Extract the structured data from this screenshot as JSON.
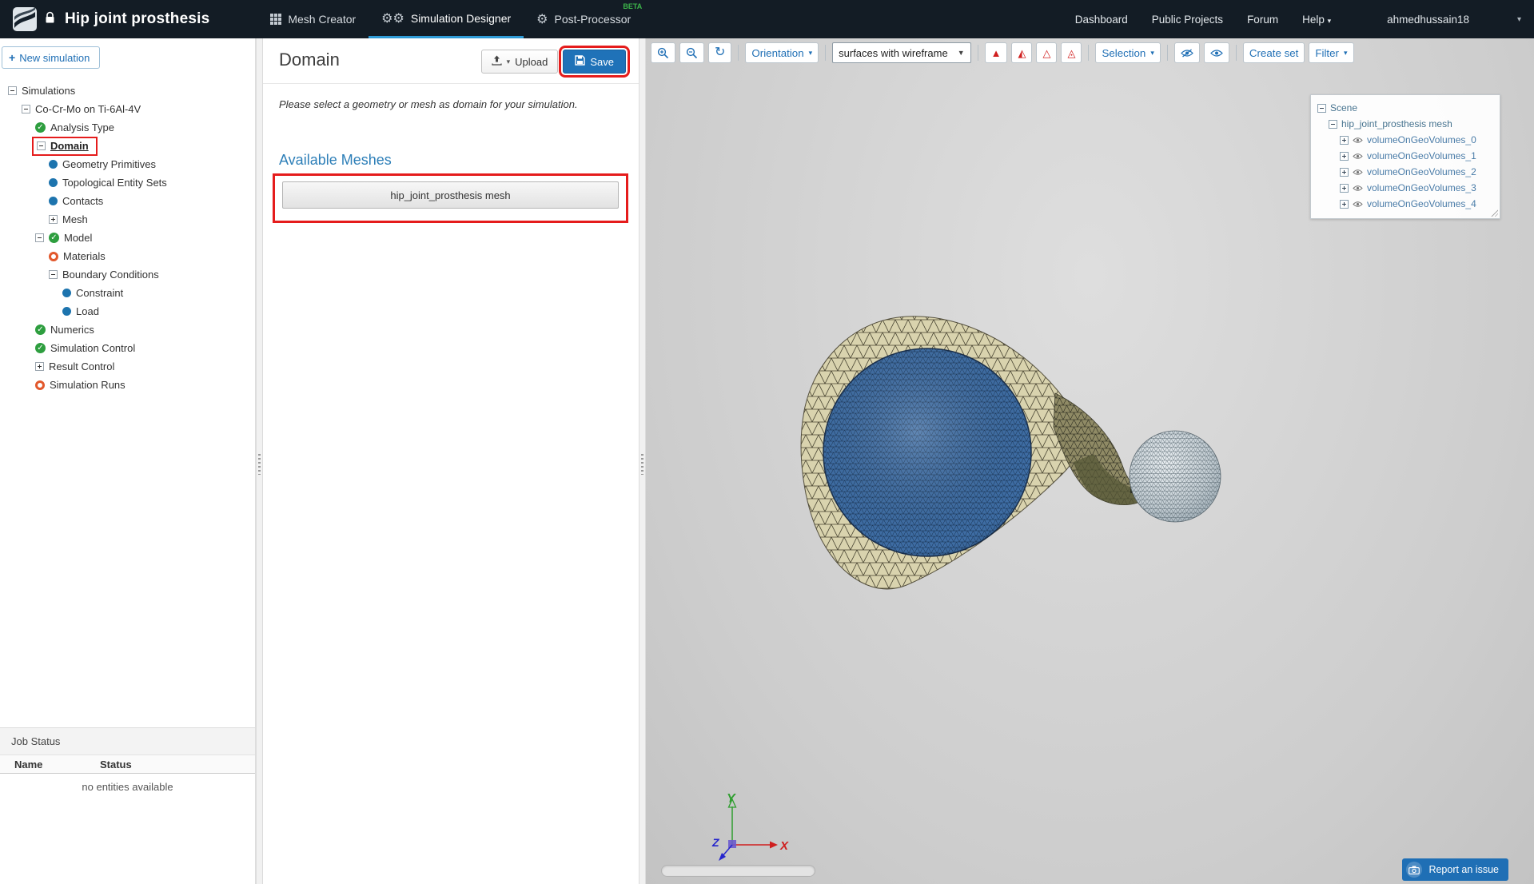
{
  "topbar": {
    "title": "Hip joint prosthesis",
    "tabs": [
      {
        "label": "Mesh Creator"
      },
      {
        "label": "Simulation Designer"
      },
      {
        "label": "Post-Processor",
        "beta": "BETA"
      }
    ],
    "links": {
      "dashboard": "Dashboard",
      "public_projects": "Public Projects",
      "forum": "Forum",
      "help": "Help"
    },
    "user": "ahmedhussain18"
  },
  "sidebar": {
    "new_simulation": "New simulation",
    "tree": [
      {
        "label": "Simulations",
        "level": 0,
        "expander": "minus"
      },
      {
        "label": "Co-Cr-Mo on Ti-6Al-4V",
        "level": 1,
        "expander": "minus"
      },
      {
        "label": "Analysis Type",
        "level": 2,
        "status": "complete"
      },
      {
        "label": "Domain",
        "level": 2,
        "expander": "minus",
        "selected": true,
        "annotated": true
      },
      {
        "label": "Geometry Primitives",
        "level": 3,
        "status": "item"
      },
      {
        "label": "Topological Entity Sets",
        "level": 3,
        "status": "item"
      },
      {
        "label": "Contacts",
        "level": 3,
        "status": "item"
      },
      {
        "label": "Mesh",
        "level": 3,
        "expander": "plus"
      },
      {
        "label": "Model",
        "level": 2,
        "expander": "minus",
        "status": "complete"
      },
      {
        "label": "Materials",
        "level": 3,
        "status": "incomplete"
      },
      {
        "label": "Boundary Conditions",
        "level": 3,
        "expander": "minus"
      },
      {
        "label": "Constraint",
        "level": 4,
        "status": "item"
      },
      {
        "label": "Load",
        "level": 4,
        "status": "item"
      },
      {
        "label": "Numerics",
        "level": 2,
        "status": "complete"
      },
      {
        "label": "Simulation Control",
        "level": 2,
        "status": "complete"
      },
      {
        "label": "Result Control",
        "level": 2,
        "expander": "plus"
      },
      {
        "label": "Simulation Runs",
        "level": 2,
        "status": "incomplete"
      }
    ],
    "job_status": {
      "title": "Job Status",
      "columns": [
        "Name",
        "Status"
      ],
      "empty": "no entities available"
    }
  },
  "panel": {
    "title": "Domain",
    "upload": "Upload",
    "save": "Save",
    "description": "Please select a geometry or mesh as domain for your simulation.",
    "available_meshes": "Available Meshes",
    "meshes": [
      "hip_joint_prosthesis mesh"
    ]
  },
  "viewer": {
    "toolbar": {
      "orientation": "Orientation",
      "render_mode": "surfaces with wireframe",
      "selection": "Selection",
      "create_set": "Create set",
      "filter": "Filter"
    },
    "scene_tree": {
      "root": "Scene",
      "mesh": "hip_joint_prosthesis mesh",
      "volumes": [
        "volumeOnGeoVolumes_0",
        "volumeOnGeoVolumes_1",
        "volumeOnGeoVolumes_2",
        "volumeOnGeoVolumes_3",
        "volumeOnGeoVolumes_4"
      ]
    },
    "axes": {
      "x": "X",
      "y": "Y",
      "z": "Z"
    },
    "report_issue": "Report an issue"
  },
  "colors": {
    "topbar_bg": "#131c25",
    "accent_blue": "#1f72b8",
    "tab_active_underline": "#2f9bd6",
    "beta_green": "#3cb54a",
    "annotation_red": "#e51c1c",
    "status_complete_green": "#2e9e3f",
    "status_item_blue": "#1d74ae",
    "status_incomplete_orange": "#e2582c",
    "heading_blue": "#2d7fb8",
    "mesh_cup_tan": "#d9d3ae",
    "mesh_disc_blue": "#3e6da4",
    "mesh_head_gray": "#c2ccd2"
  }
}
